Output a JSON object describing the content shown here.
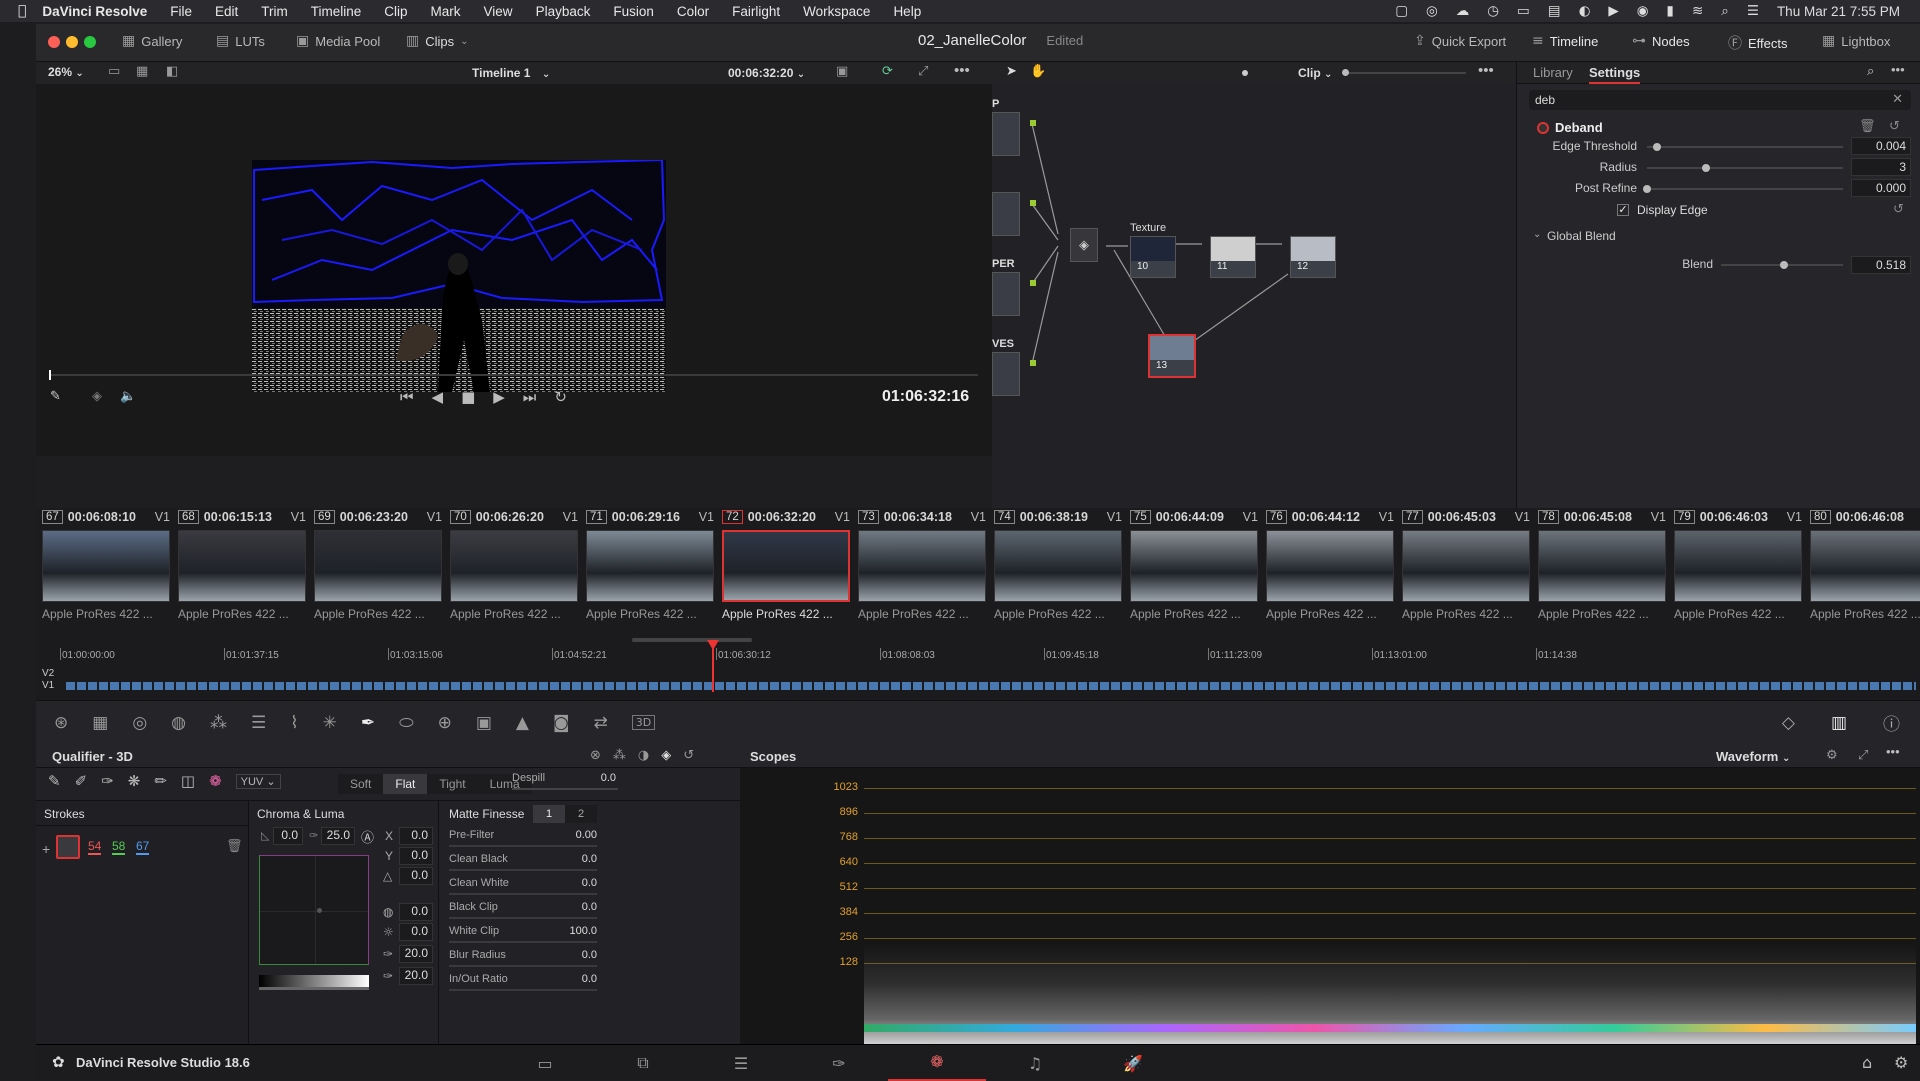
{
  "menubar": {
    "app": "DaVinci Resolve",
    "items": [
      "File",
      "Edit",
      "Trim",
      "Timeline",
      "Clip",
      "Mark",
      "View",
      "Playback",
      "Fusion",
      "Color",
      "Fairlight",
      "Workspace",
      "Help"
    ],
    "clock": "Thu Mar 21  7:55 PM"
  },
  "titlebar": {
    "gallery": "Gallery",
    "luts": "LUTs",
    "media_pool": "Media Pool",
    "clips": "Clips",
    "project": "02_JanelleColor",
    "status": "Edited",
    "quick_export": "Quick Export",
    "timeline": "Timeline",
    "nodes": "Nodes",
    "effects": "Effects",
    "lightbox": "Lightbox"
  },
  "viewer": {
    "zoom": "26%",
    "timeline_name": "Timeline 1",
    "timecode_top": "00:06:32:20",
    "timecode": "01:06:32:16"
  },
  "nodebar": {
    "mode": "Clip"
  },
  "nodes": {
    "labels": [
      "P",
      "PER",
      "VES"
    ],
    "texture_label": "Texture",
    "node10": "10",
    "node11": "11",
    "node12": "12",
    "node13": "13"
  },
  "settings": {
    "tab_library": "Library",
    "tab_settings": "Settings",
    "search_value": "deb",
    "effect_name": "Deband",
    "params": [
      {
        "label": "Edge Threshold",
        "value": "0.004",
        "pos": 0.05
      },
      {
        "label": "Radius",
        "value": "3",
        "pos": 0.3
      },
      {
        "label": "Post Refine",
        "value": "0.000",
        "pos": 0.0
      }
    ],
    "display_edge": "Display Edge",
    "global_blend": "Global Blend",
    "blend_label": "Blend",
    "blend_value": "0.518",
    "blend_pos": 0.52
  },
  "clips": [
    {
      "num": "67",
      "tc": "00:06:08:10",
      "track": "V1",
      "cap": "Apple ProRes 422 ..."
    },
    {
      "num": "68",
      "tc": "00:06:15:13",
      "track": "V1",
      "cap": "Apple ProRes 422 ..."
    },
    {
      "num": "69",
      "tc": "00:06:23:20",
      "track": "V1",
      "cap": "Apple ProRes 422 ..."
    },
    {
      "num": "70",
      "tc": "00:06:26:20",
      "track": "V1",
      "cap": "Apple ProRes 422 ..."
    },
    {
      "num": "71",
      "tc": "00:06:29:16",
      "track": "V1",
      "cap": "Apple ProRes 422 ..."
    },
    {
      "num": "72",
      "tc": "00:06:32:20",
      "track": "V1",
      "cap": "Apple ProRes 422 ..."
    },
    {
      "num": "73",
      "tc": "00:06:34:18",
      "track": "V1",
      "cap": "Apple ProRes 422 ..."
    },
    {
      "num": "74",
      "tc": "00:06:38:19",
      "track": "V1",
      "cap": "Apple ProRes 422 ..."
    },
    {
      "num": "75",
      "tc": "00:06:44:09",
      "track": "V1",
      "cap": "Apple ProRes 422 ..."
    },
    {
      "num": "76",
      "tc": "00:06:44:12",
      "track": "V1",
      "cap": "Apple ProRes 422 ..."
    },
    {
      "num": "77",
      "tc": "00:06:45:03",
      "track": "V1",
      "cap": "Apple ProRes 422 ..."
    },
    {
      "num": "78",
      "tc": "00:06:45:08",
      "track": "V1",
      "cap": "Apple ProRes 422 ..."
    },
    {
      "num": "79",
      "tc": "00:06:46:03",
      "track": "V1",
      "cap": "Apple ProRes 422 ..."
    },
    {
      "num": "80",
      "tc": "00:06:46:08",
      "track": "",
      "cap": "Apple ProRes 422 ..."
    }
  ],
  "ruler": {
    "ticks": [
      "01:00:00:00",
      "01:01:37:15",
      "01:03:15:06",
      "01:04:52:21",
      "01:06:30:12",
      "01:08:08:03",
      "01:09:45:18",
      "01:11:23:09",
      "01:13:01:00",
      "01:14:38"
    ],
    "v2": "V2",
    "v1": "V1"
  },
  "qualifier": {
    "title": "Qualifier - 3D",
    "colorspace": "YUV",
    "mode_soft": "Soft",
    "mode_flat": "Flat",
    "mode_tight": "Tight",
    "mode_luma": "Luma",
    "despill_label": "Despill",
    "despill_value": "0.0",
    "strokes_label": "Strokes",
    "stroke_vals": [
      "54",
      "58",
      "67"
    ],
    "chroma_title": "Chroma & Luma",
    "cl_a": "0.0",
    "cl_b": "25.0",
    "x_label": "X",
    "x_value": "0.0",
    "y_label": "Y",
    "y_value": "0.0",
    "r3": "0.0",
    "r4": "0.0",
    "r5": "0.0",
    "r6": "20.0",
    "r7": "20.0",
    "matte_title": "Matte Finesse",
    "matte_tab1": "1",
    "matte_tab2": "2",
    "matte": [
      {
        "label": "Pre-Filter",
        "value": "0.00"
      },
      {
        "label": "Clean Black",
        "value": "0.0"
      },
      {
        "label": "Clean White",
        "value": "0.0"
      },
      {
        "label": "Black Clip",
        "value": "0.0"
      },
      {
        "label": "White Clip",
        "value": "100.0"
      },
      {
        "label": "Blur Radius",
        "value": "0.0"
      },
      {
        "label": "In/Out Ratio",
        "value": "0.0"
      }
    ]
  },
  "scopes": {
    "title": "Scopes",
    "type": "Waveform",
    "levels": [
      "1023",
      "896",
      "768",
      "640",
      "512",
      "384",
      "256",
      "128"
    ]
  },
  "bottom": {
    "app": "DaVinci Resolve Studio 18.6"
  }
}
